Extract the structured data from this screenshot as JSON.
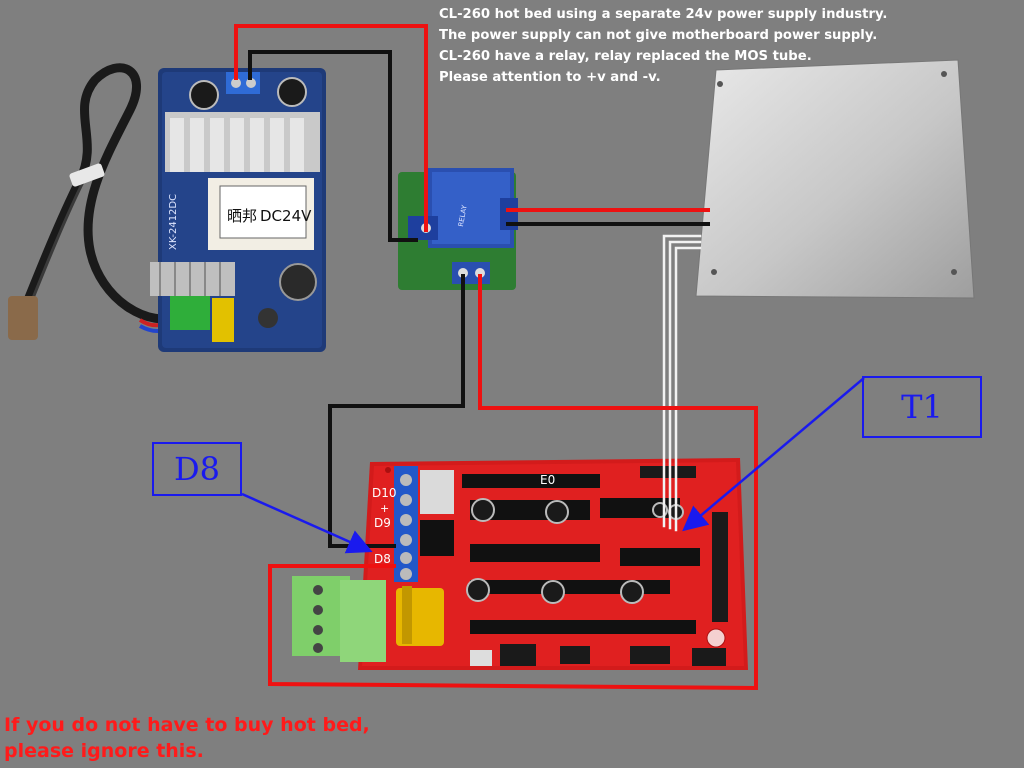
{
  "note": {
    "lines": [
      "CL-260 hot bed using a separate 24v power supply industry.",
      "The power supply can not give motherboard power supply.",
      "CL-260 have a relay, relay replaced the MOS tube.",
      "Please attention to +v and -v."
    ]
  },
  "footer": {
    "lines": [
      "If you do not have to buy hot bed,",
      "please ignore this."
    ]
  },
  "callouts": {
    "d8": "D8",
    "t1": "T1"
  },
  "power_supply": {
    "model_label": "XK-2412DC",
    "output_label": "DC24V",
    "brand_label": "晒邦"
  },
  "ramps_labels": {
    "d10": "D10",
    "d9": "D9",
    "d8": "D8",
    "e0": "E0",
    "plus": "+"
  },
  "colors": {
    "background": "#808080",
    "wire_red": "#ee1111",
    "wire_black": "#111111",
    "callout_blue": "#1a1aee",
    "note_text": "#ffffff",
    "footer_text": "#ff1a1a",
    "pcb_red": "#d81b1b",
    "pcb_blue": "#1f3f86",
    "relay_green": "#2e7d32"
  }
}
